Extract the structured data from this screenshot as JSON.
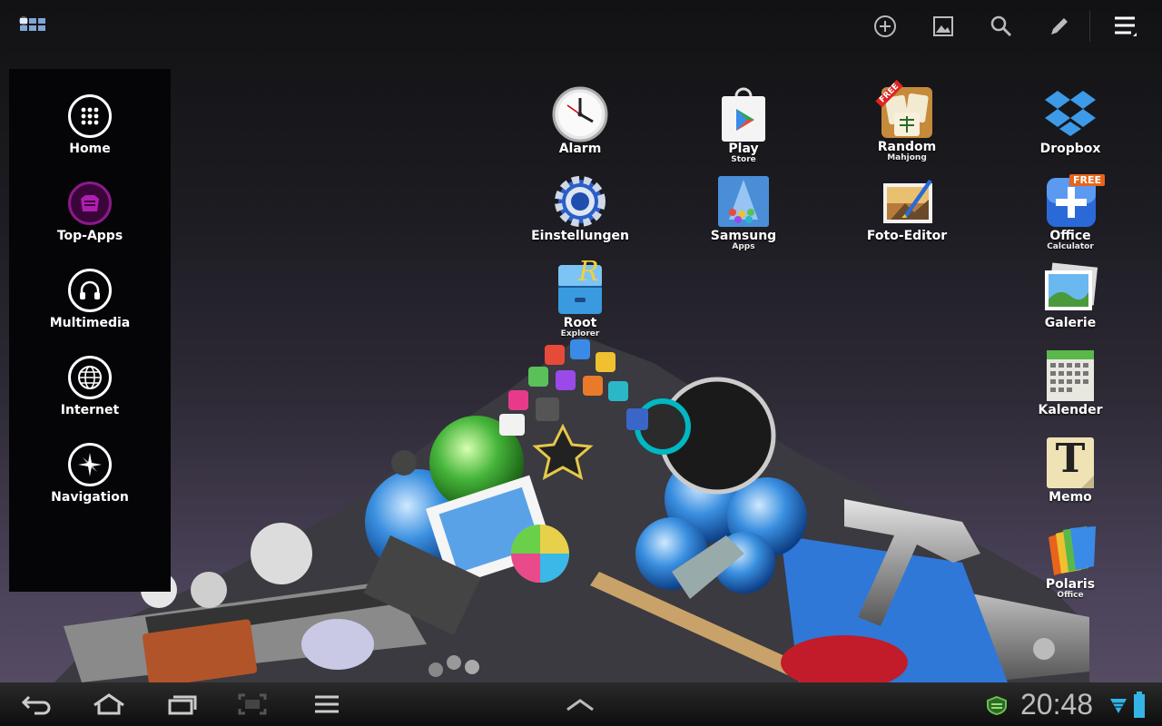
{
  "topbar": {
    "icons": [
      "apps-grid-icon",
      "add-icon",
      "wallpaper-icon",
      "search-icon",
      "edit-icon",
      "menu-icon"
    ]
  },
  "sidebar": {
    "items": [
      {
        "label": "Home",
        "icon": "home-grid-icon"
      },
      {
        "label": "Top-Apps",
        "icon": "top-apps-icon"
      },
      {
        "label": "Multimedia",
        "icon": "headphones-icon"
      },
      {
        "label": "Internet",
        "icon": "globe-icon"
      },
      {
        "label": "Navigation",
        "icon": "compass-icon"
      }
    ]
  },
  "apps": {
    "alarm": {
      "name": "Alarm"
    },
    "play": {
      "name": "Play",
      "sub": "Store"
    },
    "mahjong": {
      "name": "Random",
      "sub": "Mahjong",
      "badge": "FREE"
    },
    "dropbox": {
      "name": "Dropbox"
    },
    "settings": {
      "name": "Einstellungen"
    },
    "samsung": {
      "name": "Samsung",
      "sub": "Apps"
    },
    "foto": {
      "name": "Foto-Editor"
    },
    "office": {
      "name": "Office",
      "sub": "Calculator",
      "badge": "FREE"
    },
    "root": {
      "name": "Root",
      "sub": "Explorer",
      "glyph": "R"
    },
    "galerie": {
      "name": "Galerie"
    },
    "kalender": {
      "name": "Kalender"
    },
    "memo": {
      "name": "Memo",
      "glyph": "T"
    },
    "polaris": {
      "name": "Polaris",
      "sub": "Office"
    }
  },
  "sysbar": {
    "icons": [
      "back-icon",
      "home-icon",
      "recent-apps-icon",
      "screenshot-icon",
      "menu-icon",
      "expand-up-icon",
      "shield-icon",
      "wifi-icon",
      "battery-icon"
    ],
    "time": "20:48"
  },
  "colors": {
    "accent": "#33b5e5",
    "panel": "#050507",
    "clock": "#bdbdbd"
  }
}
